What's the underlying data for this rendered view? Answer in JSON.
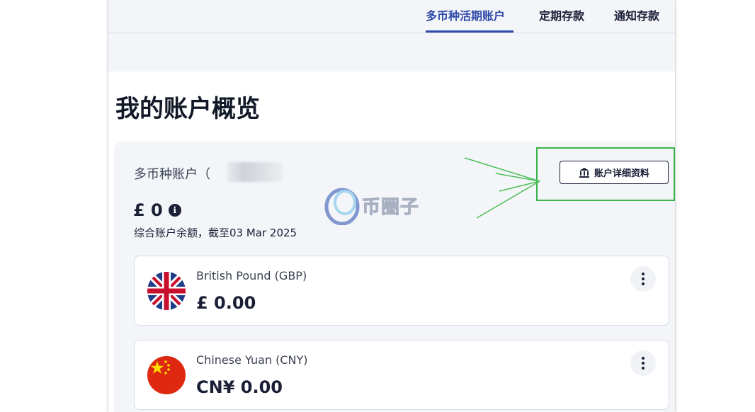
{
  "nav": {
    "tabs": [
      {
        "label": "多币种活期账户",
        "active": true
      },
      {
        "label": "定期存款",
        "active": false
      },
      {
        "label": "通知存款",
        "active": false
      }
    ]
  },
  "page": {
    "title": "我的账户概览"
  },
  "account": {
    "label": "多币种账户（",
    "details_button": "账户详细资料",
    "balance": "£ 0",
    "balance_note": "综合账户余额，截至03 Mar 2025"
  },
  "currencies": [
    {
      "name": "British Pound (GBP)",
      "amount": "£ 0.00",
      "flag": "uk-flag-icon"
    },
    {
      "name": "Chinese Yuan (CNY)",
      "amount": "CN¥ 0.00",
      "flag": "china-flag-icon"
    }
  ],
  "watermark": {
    "text": "币圈子"
  },
  "colors": {
    "accent": "#2f49a8",
    "highlight": "#3ab34a",
    "card_bg": "#f3f5f9"
  }
}
